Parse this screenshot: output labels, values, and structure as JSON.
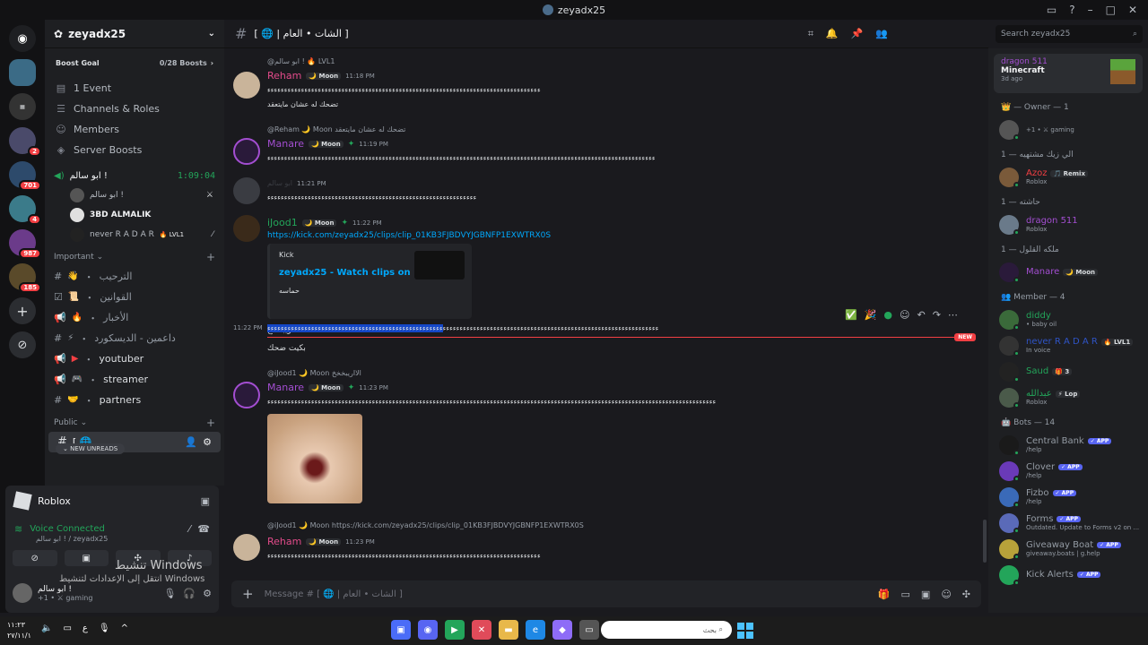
{
  "window": {
    "title": "zeyadx25"
  },
  "server": {
    "name": "zeyadx25",
    "boost_goal": "Boost Goal",
    "boost_count": "0/28 Boosts",
    "nav": [
      {
        "label": "1 Event",
        "icon": "calendar-icon"
      },
      {
        "label": "Channels & Roles",
        "icon": "list-icon"
      },
      {
        "label": "Members",
        "icon": "members-icon"
      },
      {
        "label": "Server Boosts",
        "icon": "boost-icon"
      }
    ]
  },
  "guild_badges": [
    "2",
    "701",
    "4",
    "987",
    "185"
  ],
  "voice_channel": {
    "name": "ابو سالم !",
    "timer": "1:09:04",
    "users": [
      {
        "name": "ابو سالم !"
      },
      {
        "name": "3BD ALMALIK"
      },
      {
        "name": "never R A D A R",
        "tag": "🔥 LVL1"
      }
    ]
  },
  "categories": {
    "important": "Important",
    "public": "Public"
  },
  "channels": [
    {
      "emoji": "👋",
      "name": "الترحيب"
    },
    {
      "emoji": "📜",
      "name": "القوانين"
    },
    {
      "emoji": "🔥",
      "name": "الأخبار"
    },
    {
      "emoji": "⚡",
      "name": "داعمين - الديسكورد"
    },
    {
      "emoji": "▶",
      "name": "youtuber"
    },
    {
      "emoji": "🎮",
      "name": "streamer"
    },
    {
      "emoji": "🤝",
      "name": "partners"
    }
  ],
  "selected_channel": "[ 🌐",
  "new_unreads": "NEW UNREADS",
  "game_card": {
    "name": "Roblox"
  },
  "voice_panel": {
    "status": "Voice Connected",
    "sub": "ابو سالم ! / zeyadx25"
  },
  "user_panel": {
    "name": "ابو سالم !",
    "sub": "+1 • ⚔ gaming"
  },
  "watermark": {
    "line1": "تنشيط Windows",
    "line2": "انتقل إلى الإعدادات لتنشيط Windows"
  },
  "chat": {
    "channel_title": "[ 🌐 | الشات • العام ]",
    "composer_placeholder": "Message # [ 🌐 | الشات • العام ]",
    "search_placeholder": "Search zeyadx25",
    "new_tag": "NEW",
    "messages": [
      {
        "reply": "@ابو سالم ! 🔥 LVL1",
        "user": "Reham",
        "color": "#e24b8a",
        "tag": "🌙 Moon",
        "time": "11:18 PM",
        "lines": [
          "ءءءءءءءءءءءءءءءءءءءءءءءءءءءءءءءءءءءءءءءءءءءءءءءءءءءءءءءءءءءءءءءءءءءءءءءءءءءءءءءءء",
          "تضحك له عشان مايتعقد"
        ]
      },
      {
        "reply": "@Reham 🌙 Moon تضحك له عشان مايتعقد",
        "user": "Manare",
        "color": "#a34ed1",
        "tag": "🌙 Moon",
        "time": "11:19 PM",
        "lines": [
          "ءءءءءءءءءءءءءءءءءءءءءءءءءءءءءءءءءءءءءءءءءءءءءءءءءءءءءءءءءءءءءءءءءءءءءءءءءءءءءءءءءءءءءءءءءءءءءءءءءءءءءءءءءءءءءءءءءءء"
        ]
      },
      {
        "user": "ابو سالم",
        "color": "#3a3c42",
        "time": "11:21 PM",
        "lines": [
          "ءءءءءءءءءءءءءءءءءءءءءءءءءءءءءءءءءءءءءءءءءءءءءءءءءءءءءءءءءءءءءء"
        ]
      },
      {
        "user": "iJood1",
        "color": "#23a55a",
        "tag": "🌙 Moon",
        "time": "11:22 PM",
        "link": "https://kick.com/zeyadx25/clips/clip_01KB3FJBDVYJGBNFP1EXWTRX0S",
        "embed": {
          "provider": "Kick",
          "title": "zeyadx25 - Watch clips on Kick",
          "desc": "حماسه"
        },
        "lines": [
          "الااريبخخخ"
        ],
        "hl_line": "ءءءءءءءءءءءءءءءءءءءءءءءءءءءءءءءءءءءءءءءءءءءءءءءءءءءءءءءءءءءءءءءء",
        "hl_line2": "ءءءءءءءءءءءءءءءءءءءءءءءءءءءءءءءءءءءءءءءءءءءءءءءءءءءء",
        "hl_time": "11:22 PM",
        "after": "بكيت ضحك"
      },
      {
        "reply": "@iJood1 🌙 Moon الااريبخخخ",
        "user": "Manare",
        "color": "#a34ed1",
        "tag": "🌙 Moon",
        "time": "11:23 PM",
        "lines": [
          "ءءءءءءءءءءءءءءءءءءءءءءءءءءءءءءءءءءءءءءءءءءءءءءءءءءءءءءءءءءءءءءءءءءءءءءءءءءءءءءءءءءءءءءءءءءءءءءءءءءءءءءءءءءءءءءءءءءءءءءءءءءءءءءءءءءءءء"
        ]
      },
      {
        "reply": "@iJood1 🌙 Moon https://kick.com/zeyadx25/clips/clip_01KB3FJBDVYJGBNFP1EXWTRX0S",
        "user": "Reham",
        "color": "#e24b8a",
        "tag": "🌙 Moon",
        "time": "11:23 PM",
        "lines": [
          "ءءءءءءءءءءءءءءءءءءءءءءءءءءءءءءءءءءءءءءءءءءءءءءءءءءءءءءءءءءءءءءءءءءءءءءءءءءءءءءءءء"
        ]
      }
    ]
  },
  "members": {
    "activity": {
      "name": "dragon 511",
      "game": "Minecraft",
      "time": "3d ago"
    },
    "sections": [
      {
        "title": "👑 — Owner — 1",
        "rows": [
          {
            "name": "",
            "sub": "+1 • ⚔ gaming",
            "color": "#dbdee1"
          }
        ]
      },
      {
        "title": "الي زيك مشتهيه — 1",
        "rows": [
          {
            "name": "Azoz",
            "tag": "🎵 Remix",
            "sub": "Roblox",
            "color": "#f23f43"
          }
        ]
      },
      {
        "title": "حاشته — 1",
        "rows": [
          {
            "name": "dragon 511",
            "sub": "Roblox",
            "color": "#a34ed1"
          }
        ]
      },
      {
        "title": "ملكه القلول — 1",
        "rows": [
          {
            "name": "Manare",
            "tag": "🌙 Moon",
            "sub": "",
            "color": "#a34ed1"
          }
        ]
      },
      {
        "title": "👥 Member — 4",
        "rows": [
          {
            "name": "diddy",
            "sub": "• baby oil",
            "color": "#23a55a"
          },
          {
            "name": "never R A D A R",
            "tag": "🔥 LVL1",
            "sub": "In voice",
            "color": "#2f54c7"
          },
          {
            "name": "Saud",
            "tag": "🎁 3",
            "sub": "",
            "color": "#23a55a"
          },
          {
            "name": "عبدالله",
            "tag": "⚡ Lop",
            "sub": "Roblox",
            "color": "#23a55a"
          }
        ]
      },
      {
        "title": "🤖 Bots — 14",
        "rows": [
          {
            "name": "Central Bank",
            "tag": "✓ APP",
            "sub": "/help",
            "color": "#949ba4"
          },
          {
            "name": "Clover",
            "tag": "✓ APP",
            "sub": "/help",
            "color": "#949ba4"
          },
          {
            "name": "Fizbo",
            "tag": "✓ APP",
            "sub": "/help",
            "color": "#949ba4"
          },
          {
            "name": "Forms",
            "tag": "✓ APP",
            "sub": "Outdated. Update to Forms v2 on ...",
            "color": "#949ba4"
          },
          {
            "name": "Giveaway Boat",
            "tag": "✓ APP",
            "sub": "giveaway.boats | g.help",
            "color": "#949ba4"
          },
          {
            "name": "Kick Alerts",
            "tag": "✓ APP",
            "sub": "",
            "color": "#949ba4"
          }
        ]
      }
    ]
  },
  "taskbar": {
    "clock": "١١:٢٣",
    "date": "٢٧/١١/١",
    "lang": "ع",
    "search": "بحث"
  }
}
